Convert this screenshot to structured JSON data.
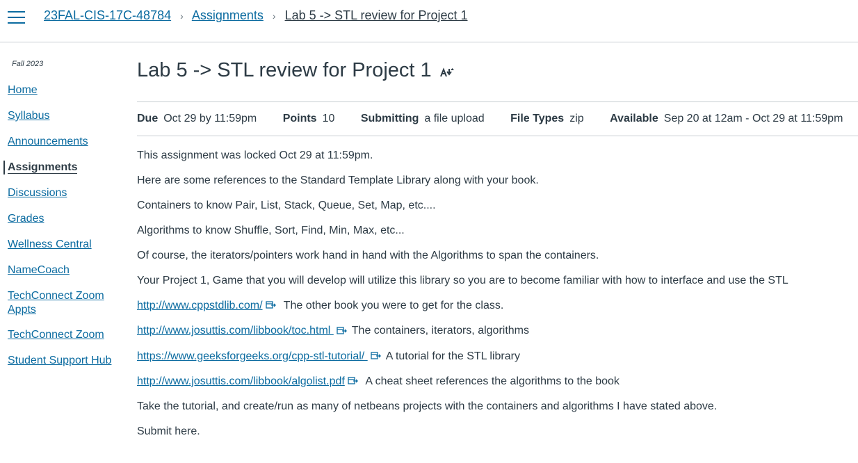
{
  "header": {
    "breadcrumb": {
      "course": "23FAL-CIS-17C-48784",
      "section": "Assignments",
      "current": "Lab 5 -> STL review for Project 1",
      "separator": "›"
    }
  },
  "sidebar": {
    "term": "Fall 2023",
    "items": [
      {
        "label": "Home"
      },
      {
        "label": "Syllabus"
      },
      {
        "label": "Announcements"
      },
      {
        "label": "Assignments"
      },
      {
        "label": "Discussions"
      },
      {
        "label": "Grades"
      },
      {
        "label": "Wellness Central"
      },
      {
        "label": "NameCoach"
      },
      {
        "label": "TechConnect Zoom Appts"
      },
      {
        "label": "TechConnect Zoom"
      },
      {
        "label": "Student Support Hub"
      }
    ],
    "active_index": 3
  },
  "assignment": {
    "title": "Lab 5 -> STL review for Project 1",
    "details": {
      "due_label": "Due",
      "due_value": "Oct 29 by 11:59pm",
      "points_label": "Points",
      "points_value": "10",
      "submitting_label": "Submitting",
      "submitting_value": "a file upload",
      "filetypes_label": "File Types",
      "filetypes_value": "zip",
      "available_label": "Available",
      "available_value": "Sep 20 at 12am - Oct 29 at 11:59pm"
    },
    "locked_notice": "This assignment was locked Oct 29 at 11:59pm.",
    "paragraphs": {
      "intro": "Here are some references to the Standard Template Library along with your book.",
      "containers": "Containers to know  Pair, List, Stack, Queue, Set, Map, etc....",
      "algorithms": "Algorithms to know  Shuffle, Sort, Find, Min, Max, etc...",
      "iterators": "Of course, the iterators/pointers work hand in hand with the Algorithms to span the containers.",
      "project": "Your Project 1, Game that you will develop will utilize this library so you are to become familiar with how to interface and use the STL",
      "tutorial": "Take the tutorial, and create/run as many of netbeans projects with the containers and algorithms I have stated above.",
      "submit": "Submit here."
    },
    "links": [
      {
        "url": "http://www.cppstdlib.com/",
        "note": " The other book you were to get for the class."
      },
      {
        "url": "http://www.josuttis.com/libbook/toc.html ",
        "note": "The containers, iterators, algorithms"
      },
      {
        "url": "https://www.geeksforgeeks.org/cpp-stl-tutorial/ ",
        "note": "A tutorial for the STL library"
      },
      {
        "url": "http://www.josuttis.com/libbook/algolist.pdf",
        "note": " A cheat sheet references the algorithms to the book"
      }
    ]
  },
  "colors": {
    "link": "#0b6ba0",
    "text": "#2d3b45",
    "divider": "#c7cdd1"
  }
}
